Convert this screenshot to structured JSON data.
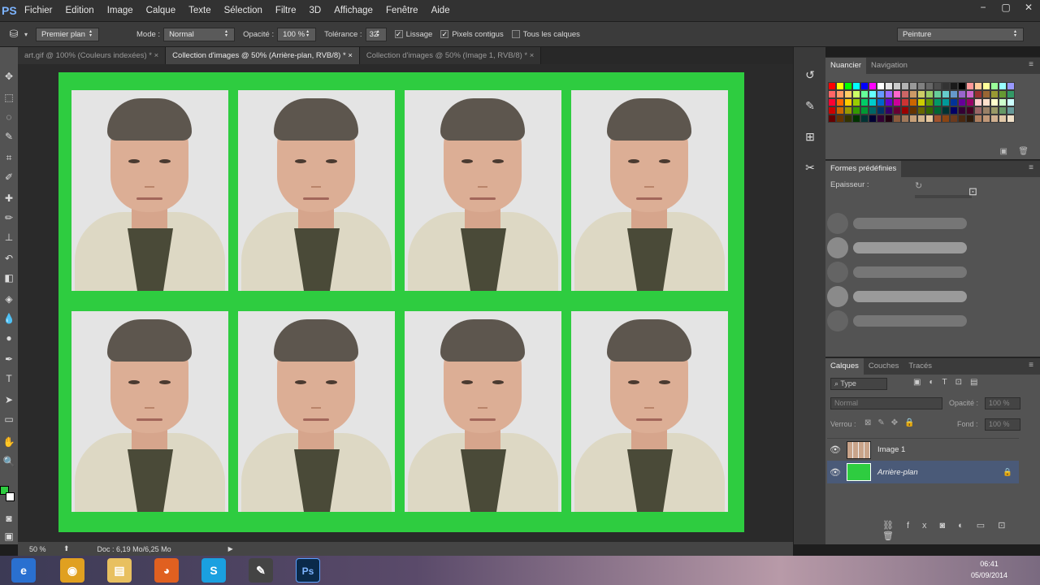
{
  "app": {
    "logo": "PS"
  },
  "menu": [
    "Fichier",
    "Edition",
    "Image",
    "Calque",
    "Texte",
    "Sélection",
    "Filtre",
    "3D",
    "Affichage",
    "Fenêtre",
    "Aide"
  ],
  "window_controls": [
    "−",
    "▢",
    "✕"
  ],
  "options": {
    "preset": "Premier plan",
    "mode_label": "Mode :",
    "mode_value": "Normal",
    "opacity_label": "Opacité :",
    "opacity_value": "100 %",
    "tolerance_label": "Tolérance :",
    "tolerance_value": "32",
    "check_lissage": "Lissage",
    "check_pixels": "Pixels contigus",
    "check_all_layers": "Tous les calques",
    "workspace": "Peinture"
  },
  "tabs": [
    {
      "label": "art.gif @ 100% (Couleurs indexées) *",
      "active": false
    },
    {
      "label": "Collection d'images @ 50% (Arrière-plan, RVB/8) *",
      "active": true
    },
    {
      "label": "Collection d'images @ 50% (Image 1, RVB/8) *",
      "active": false
    }
  ],
  "tab_close": "×",
  "panels": {
    "swatches_tabs": [
      "Nuancier",
      "Navigation"
    ],
    "presets_title": "Formes prédéfinies",
    "presets_thickness_label": "Epaisseur :",
    "layers_tabs": [
      "Calques",
      "Couches",
      "Tracés"
    ],
    "layers_filter": "Type",
    "blend_mode": "Normal",
    "opacity_label": "Opacité :",
    "opacity_value": "100 %",
    "lock_label": "Verrou :",
    "fill_label": "Fond :",
    "fill_value": "100 %",
    "layers": [
      {
        "name": "Image 1"
      },
      {
        "name": "Arrière-plan"
      }
    ]
  },
  "status": {
    "zoom": "50 %",
    "doc": "Doc : 6,19 Mo/6,25 Mo"
  },
  "taskbar": {
    "time": "06:41",
    "date": "05/09/2014"
  },
  "colors": {
    "canvas_green": "#2ecc40",
    "foreground": "#2ecc40",
    "background": "#ffffff"
  },
  "swatches": [
    "#ff0000",
    "#ffff00",
    "#00ff00",
    "#00ffff",
    "#0000ff",
    "#ff00ff",
    "#ffffff",
    "#e6e6e6",
    "#cccccc",
    "#b3b3b3",
    "#999999",
    "#808080",
    "#666666",
    "#4d4d4d",
    "#333333",
    "#1a1a1a",
    "#000000",
    "#ff9999",
    "#ffcc99",
    "#ffff99",
    "#99ff99",
    "#99ffff",
    "#9999ff",
    "#ff6666",
    "#ff9966",
    "#ffcc66",
    "#ccff66",
    "#66ff99",
    "#66ffff",
    "#6699ff",
    "#9966ff",
    "#ff66cc",
    "#cc6666",
    "#cc9966",
    "#cccc66",
    "#99cc66",
    "#66cc99",
    "#66cccc",
    "#6699cc",
    "#9966cc",
    "#cc66cc",
    "#993333",
    "#996633",
    "#999933",
    "#669933",
    "#339966",
    "#ff0033",
    "#ff6600",
    "#ffcc00",
    "#99cc00",
    "#00cc66",
    "#00cccc",
    "#0066cc",
    "#6600cc",
    "#cc0099",
    "#cc3333",
    "#cc6600",
    "#cccc00",
    "#669900",
    "#009966",
    "#009999",
    "#003399",
    "#660099",
    "#990066",
    "#ffcccc",
    "#ffe0cc",
    "#ffffcc",
    "#ccffcc",
    "#ccffff",
    "#cc0000",
    "#cc6600",
    "#999900",
    "#339900",
    "#009933",
    "#006666",
    "#003366",
    "#330066",
    "#660033",
    "#990000",
    "#663300",
    "#666600",
    "#336600",
    "#006633",
    "#003333",
    "#000066",
    "#330033",
    "#440022",
    "#996666",
    "#998066",
    "#999966",
    "#669966",
    "#669999",
    "#660000",
    "#663300",
    "#333300",
    "#003300",
    "#003333",
    "#000033",
    "#330033",
    "#220011",
    "#8b5a3c",
    "#a0785a",
    "#c8a078",
    "#d2b48c",
    "#e6c8a0",
    "#a0522d",
    "#8b4513",
    "#6b3a1e",
    "#4a2810",
    "#2e1a0a",
    "#b08060",
    "#c09878",
    "#d0b090",
    "#e0c8a8",
    "#f0e0c8"
  ]
}
